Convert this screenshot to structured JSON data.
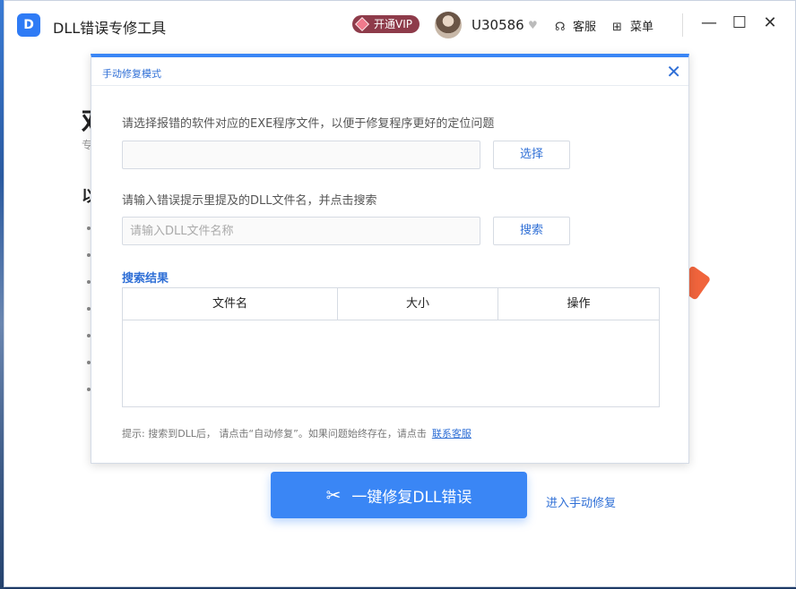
{
  "app": {
    "title": "DLL错误专修工具",
    "logo_text": "D",
    "vip_label": "开通VIP",
    "username": "U30586",
    "service_label": "客服",
    "menu_label": "菜单"
  },
  "background": {
    "big_char": "欢",
    "small_char": "专",
    "heading_char": "以",
    "fix_button_label": "一键修复DLL错误",
    "manual_link": "进入手动修复"
  },
  "modal": {
    "title": "手动修复模式",
    "exe_prompt": "请选择报错的软件对应的EXE程序文件，以便于修复程序更好的定位问题",
    "exe_value": "",
    "select_button": "选择",
    "dll_prompt": "请输入错误提示里提及的DLL文件名，并点击搜索",
    "dll_placeholder": "请输入DLL文件名称",
    "search_button": "搜索",
    "results_label": "搜索结果",
    "columns": [
      "文件名",
      "大小",
      "操作"
    ],
    "tip": "提示:  搜索到DLL后， 请点击“自动修复”。如果问题始终存在，请点击",
    "contact_link": "联系客服"
  },
  "colors": {
    "accent": "#3a86f5",
    "link": "#2f6fd6",
    "vip_bg": "#8e3b4a"
  }
}
